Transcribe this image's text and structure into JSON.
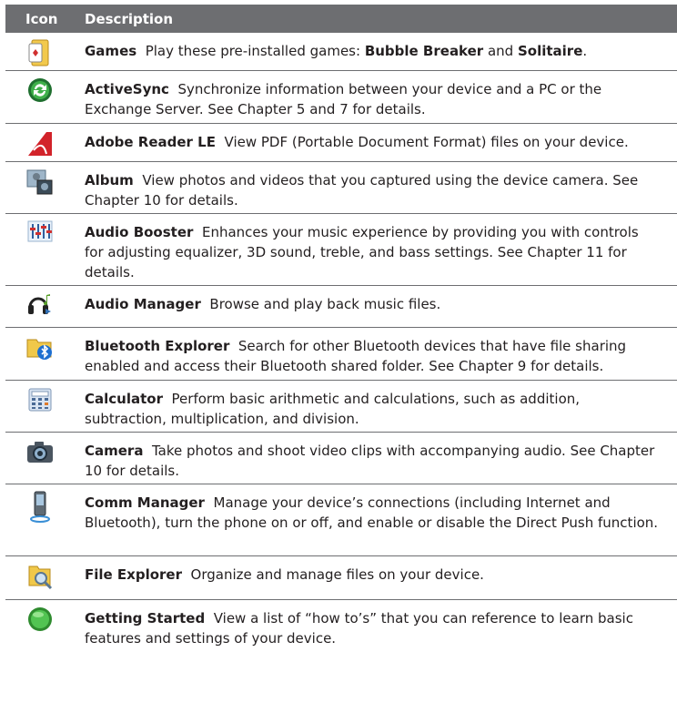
{
  "header": {
    "icon": "Icon",
    "description": "Description"
  },
  "rows": [
    {
      "icon": "games-icon",
      "name": "Games",
      "pre": "Play these pre-installed games: ",
      "b1": "Bubble Breaker",
      "mid": " and ",
      "b2": "Solitaire",
      "post": "."
    },
    {
      "icon": "activesync-icon",
      "name": "ActiveSync",
      "text": "Synchronize information between your device and a PC or the Exchange Server. See Chapter 5 and 7 for details."
    },
    {
      "icon": "adobe-reader-icon",
      "name": "Adobe Reader LE",
      "text": "View PDF (Portable Document Format) files on your device."
    },
    {
      "icon": "album-icon",
      "name": "Album",
      "text": "View photos and videos that you captured using the device camera. See Chapter 10 for details."
    },
    {
      "icon": "audio-booster-icon",
      "name": "Audio Booster",
      "text": "Enhances your music experience by providing you with controls for adjusting equalizer, 3D sound, treble, and bass settings. See Chapter 11 for details."
    },
    {
      "icon": "audio-manager-icon",
      "name": "Audio Manager",
      "text": "Browse and play back music files."
    },
    {
      "icon": "bluetooth-explorer-icon",
      "name": "Bluetooth Explorer",
      "text": "Search for other Bluetooth devices that have file sharing enabled and access their Bluetooth shared folder. See Chapter 9 for details."
    },
    {
      "icon": "calculator-icon",
      "name": "Calculator",
      "text": "Perform basic arithmetic and calculations, such as addition, subtraction, multiplication, and division."
    },
    {
      "icon": "camera-icon",
      "name": "Camera",
      "text": "Take photos and shoot video clips with accompanying audio. See Chapter 10 for details."
    },
    {
      "icon": "comm-manager-icon",
      "name": "Comm Manager",
      "text": "Manage your device’s connections (including Internet and Bluetooth), turn the phone on or off, and enable or disable the Direct Push function."
    },
    {
      "icon": "file-explorer-icon",
      "name": "File Explorer",
      "text": "Organize and manage files on your device."
    },
    {
      "icon": "getting-started-icon",
      "name": "Getting Started",
      "text": "View a list of “how to’s” that you can reference to learn basic features and settings of your device."
    }
  ]
}
